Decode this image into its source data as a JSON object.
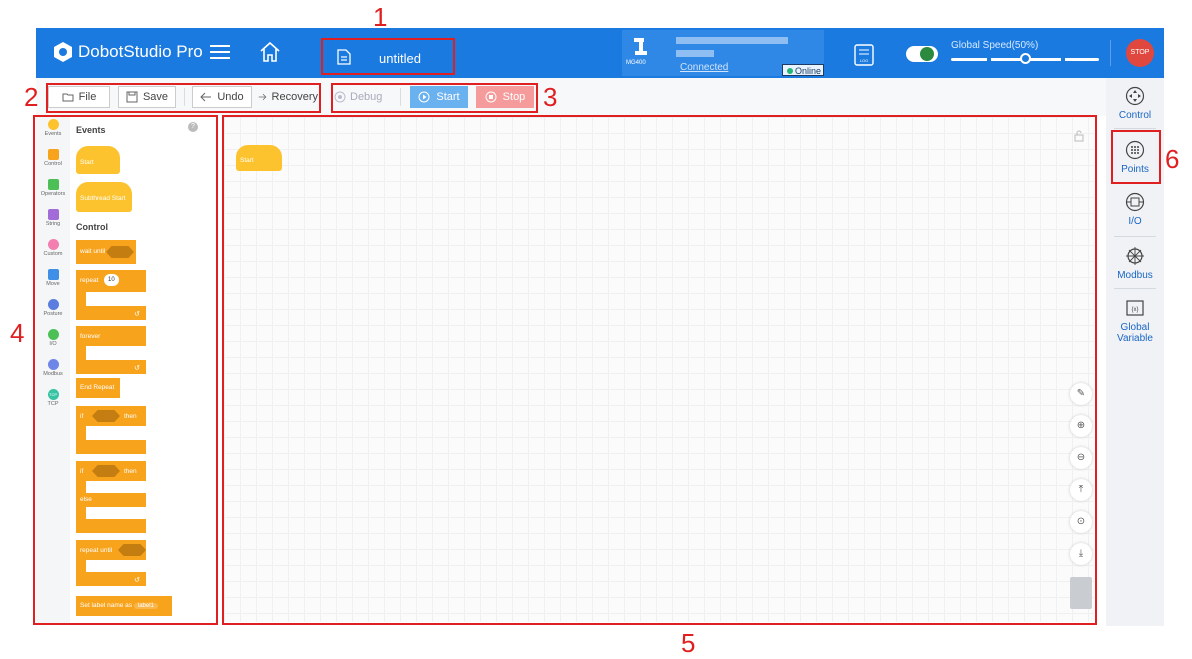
{
  "header": {
    "app_title": "DobotStudio Pro",
    "file_name": "untitled",
    "robot_model": "MG400",
    "connection_status": "Connected",
    "online_badge": "Online",
    "log_label": "LOG",
    "speed_label": "Global Speed(50%)",
    "speed_value": 0.5,
    "stop_label": "STOP",
    "brand_color": "#1a7ae0"
  },
  "toolbar": {
    "file": "File",
    "save": "Save",
    "undo": "Undo",
    "recovery": "Recovery",
    "debug": "Debug",
    "start": "Start",
    "stop": "Stop"
  },
  "categories": [
    "Events",
    "Control",
    "Operators",
    "String",
    "Custom",
    "Move",
    "Posture",
    "I/O",
    "Modbus",
    "TCP"
  ],
  "category_icons": [
    "TCP"
  ],
  "palette": {
    "events_head": "Events",
    "start_block": "Start",
    "subthread_block": "Subthread Start",
    "control_head": "Control",
    "wait_until": "wait until",
    "repeat": "repeat",
    "repeat_count": "10",
    "forever": "forever",
    "end_repeat": "End Repeat",
    "if": "if",
    "then": "then",
    "if2": "if",
    "then2": "then",
    "else": "else",
    "repeat_until": "repeat until",
    "set_label": "Set label name as",
    "label_value": "label1",
    "help": "?"
  },
  "canvas": {
    "start_block": "Start"
  },
  "right_panel": {
    "control": "Control",
    "points": "Points",
    "io": "I/O",
    "modbus": "Modbus",
    "global_variable": "Global Variable"
  },
  "annotations": [
    "1",
    "2",
    "3",
    "4",
    "5",
    "6"
  ]
}
